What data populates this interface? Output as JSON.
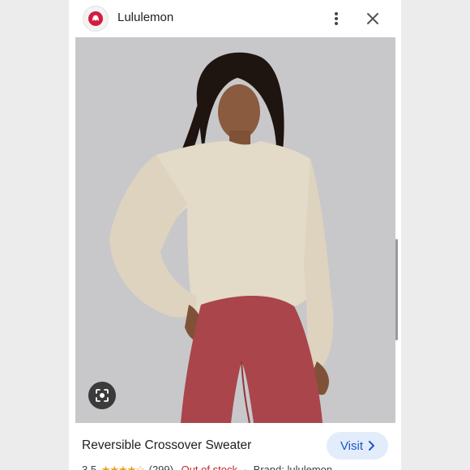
{
  "header": {
    "site_name": "Lululemon",
    "brand_color": "#d31c3d"
  },
  "product": {
    "title": "Reversible Crossover Sweater",
    "visit_label": "Visit",
    "rating": "3.5",
    "stars_text": "★★★★☆",
    "reviews": "(299)",
    "stock": "Out of stock",
    "separator": "·",
    "brand": "Brand: lululemon"
  },
  "icons": {
    "more": "more-vert-icon",
    "close": "close-icon",
    "lens": "lens-icon",
    "visit_chevron": "chevron-right-icon"
  },
  "colors": {
    "accent": "#1a57c9",
    "visit_bg": "#e3ecfb",
    "out_of_stock": "#c5221f",
    "star": "#e8a317"
  }
}
